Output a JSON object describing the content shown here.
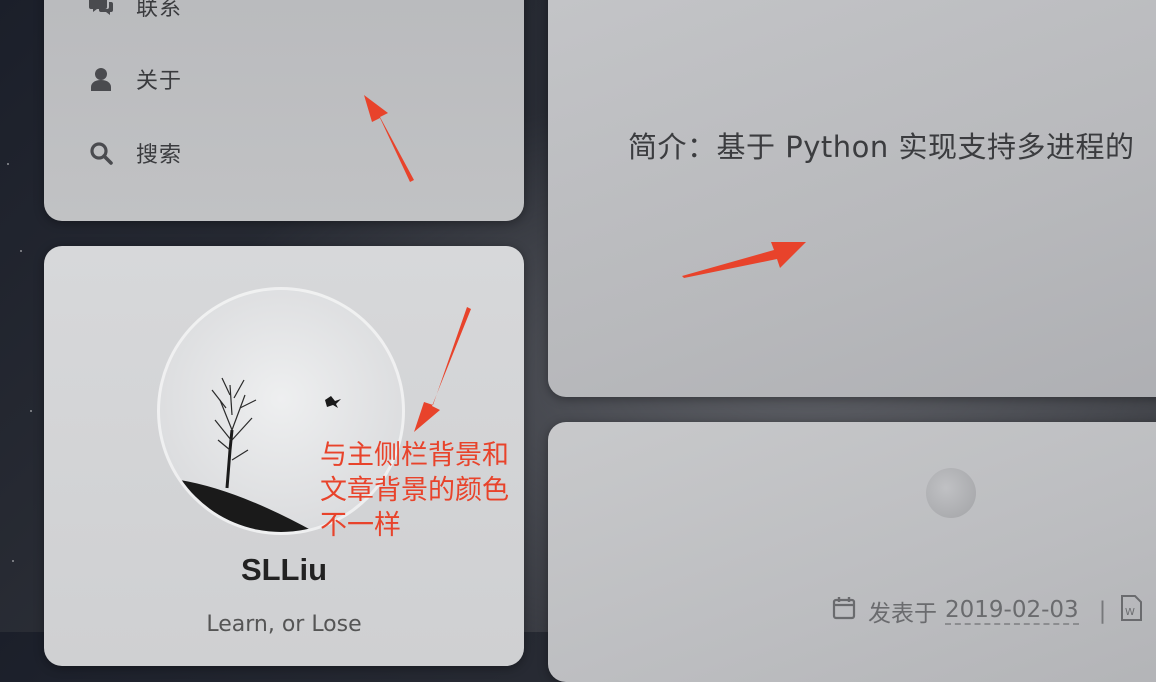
{
  "sidebar_menu": {
    "items": [
      {
        "label": "联系",
        "icon": "comments-icon"
      },
      {
        "label": "关于",
        "icon": "user-icon"
      },
      {
        "label": "搜索",
        "icon": "search-icon"
      }
    ]
  },
  "profile": {
    "name": "SLLiu",
    "motto": "Learn, or Lose"
  },
  "post": {
    "summary": "简介：基于 Python 实现支持多进程的",
    "published_label": "发表于",
    "published_date": "2019-02-03",
    "separator": "|"
  },
  "annotation": {
    "lines": [
      "与主侧栏背景和",
      "文章背景的颜色",
      "不一样"
    ],
    "color": "#e8432b"
  },
  "colors": {
    "page_background": "#22252d",
    "sidebar_card": "#bcbdc0",
    "profile_card": "#d5d6d8",
    "post_card": "#bdbec1"
  }
}
